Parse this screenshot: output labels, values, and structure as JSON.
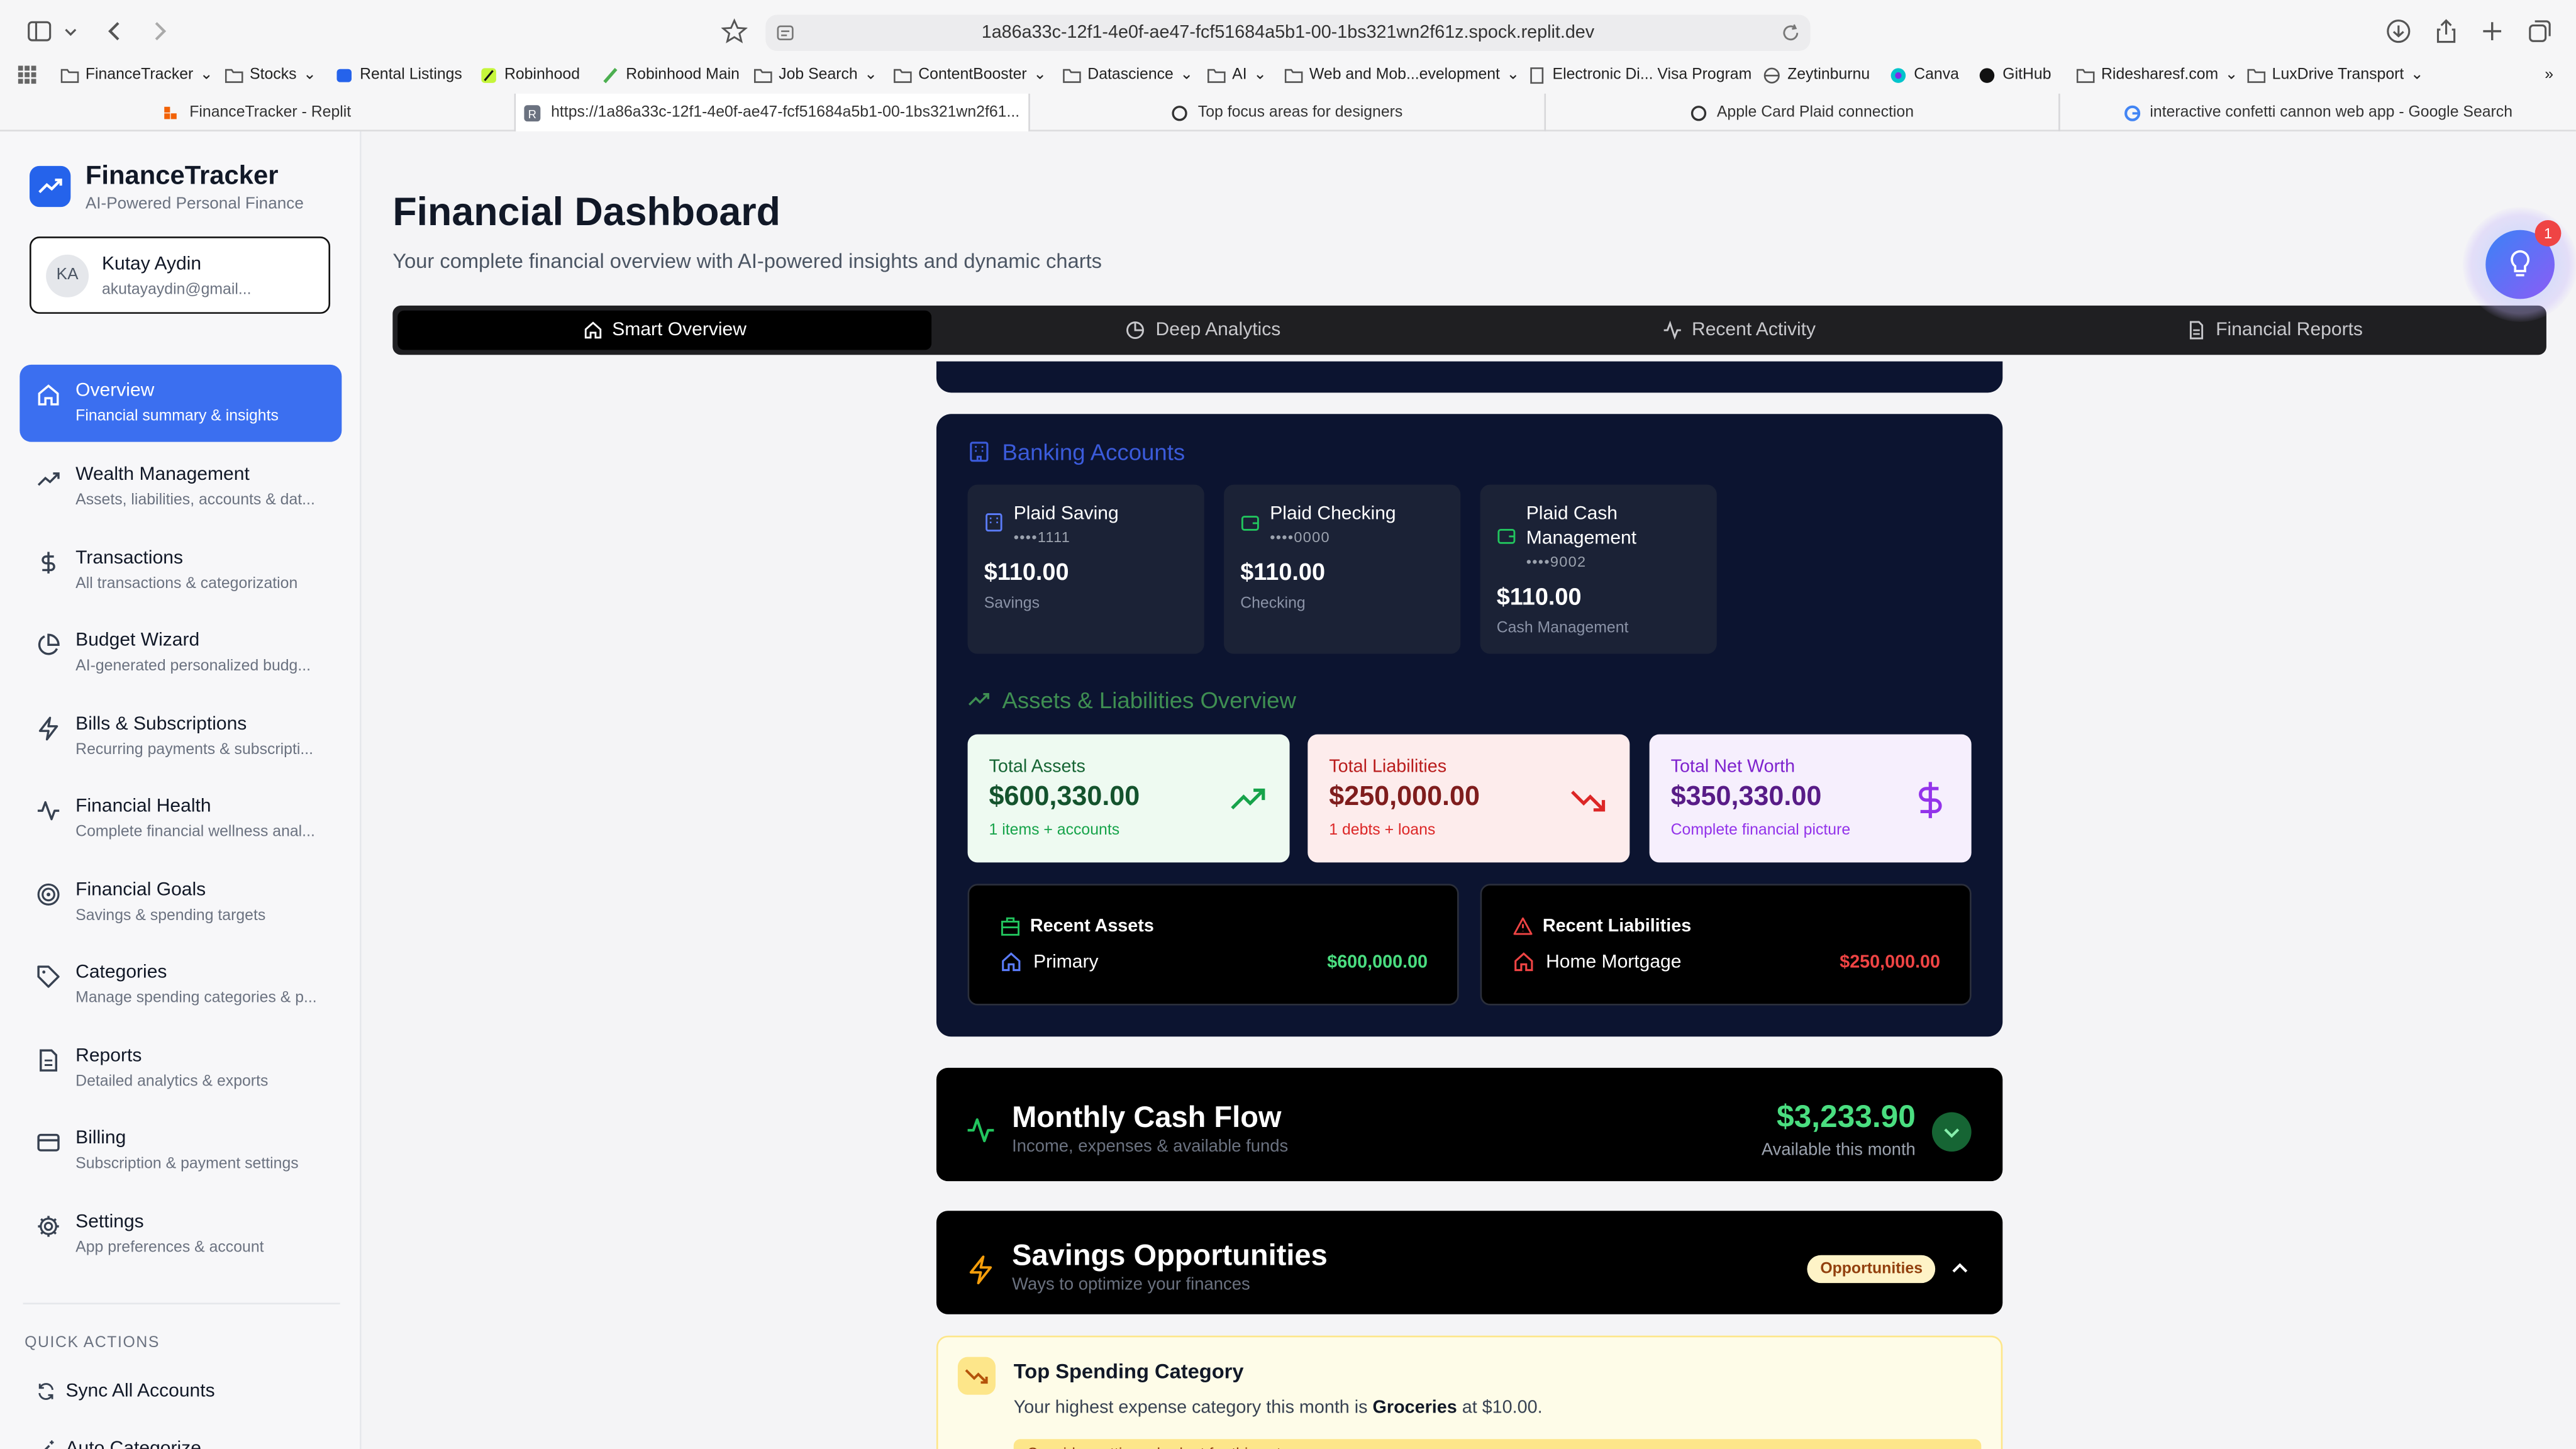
{
  "browser": {
    "url": "1a86a33c-12f1-4e0f-ae47-fcf51684a5b1-00-1bs321wn2f61z.spock.replit.dev",
    "bookmarks": [
      "FinanceTracker",
      "Stocks",
      "Rental Listings",
      "Robinhood",
      "Robinhood Main",
      "Job Search",
      "ContentBooster",
      "Datascience",
      "AI",
      "Web and Mob...evelopment",
      "Electronic Di... Visa Program",
      "Zeytinburnu",
      "Canva",
      "GitHub",
      "Ridesharesf.com",
      "LuxDrive Transport"
    ],
    "tabs": [
      "FinanceTracker - Replit",
      "https://1a86a33c-12f1-4e0f-ae47-fcf51684a5b1-00-1bs321wn2f61...",
      "Top focus areas for designers",
      "Apple Card Plaid connection",
      "interactive confetti cannon web app - Google Search"
    ]
  },
  "sidebar": {
    "app_name": "FinanceTracker",
    "app_tagline": "AI-Powered Personal Finance",
    "user": {
      "initials": "KA",
      "name": "Kutay Aydin",
      "email": "akutayaydin@gmail..."
    },
    "items": [
      {
        "label": "Overview",
        "sub": "Financial summary & insights",
        "icon": "home-icon"
      },
      {
        "label": "Wealth Management",
        "sub": "Assets, liabilities, accounts & dat...",
        "icon": "trending-up-icon"
      },
      {
        "label": "Transactions",
        "sub": "All transactions & categorization",
        "icon": "dollar-icon"
      },
      {
        "label": "Budget Wizard",
        "sub": "AI-generated personalized budg...",
        "icon": "pie-chart-icon"
      },
      {
        "label": "Bills & Subscriptions",
        "sub": "Recurring payments & subscripti...",
        "icon": "zap-icon"
      },
      {
        "label": "Financial Health",
        "sub": "Complete financial wellness anal...",
        "icon": "activity-icon"
      },
      {
        "label": "Financial Goals",
        "sub": "Savings & spending targets",
        "icon": "target-icon"
      },
      {
        "label": "Categories",
        "sub": "Manage spending categories & p...",
        "icon": "tag-icon"
      },
      {
        "label": "Reports",
        "sub": "Detailed analytics & exports",
        "icon": "file-icon"
      },
      {
        "label": "Billing",
        "sub": "Subscription & payment settings",
        "icon": "card-icon"
      },
      {
        "label": "Settings",
        "sub": "App preferences & account",
        "icon": "gear-icon"
      }
    ],
    "quick_actions_title": "QUICK ACTIONS",
    "quick_actions": [
      "Sync All Accounts",
      "Auto Categorize"
    ]
  },
  "header": {
    "title": "Financial Dashboard",
    "subtitle": "Your complete financial overview with AI-powered insights and dynamic charts",
    "tabs": [
      "Smart Overview",
      "Deep Analytics",
      "Recent Activity",
      "Financial Reports"
    ],
    "ai_badge_count": "1"
  },
  "banking": {
    "title": "Banking Accounts",
    "accounts": [
      {
        "name": "Plaid Saving",
        "mask": "••••1111",
        "balance": "$110.00",
        "type": "Savings"
      },
      {
        "name": "Plaid Checking",
        "mask": "••••0000",
        "balance": "$110.00",
        "type": "Checking"
      },
      {
        "name": "Plaid Cash Management",
        "mask": "••••9002",
        "balance": "$110.00",
        "type": "Cash Management"
      }
    ]
  },
  "overview": {
    "title": "Assets & Liabilities Overview",
    "assets": {
      "label": "Total Assets",
      "value": "$600,330.00",
      "sub": "1 items + accounts"
    },
    "liabilities": {
      "label": "Total Liabilities",
      "value": "$250,000.00",
      "sub": "1 debts + loans"
    },
    "net_worth": {
      "label": "Total Net Worth",
      "value": "$350,330.00",
      "sub": "Complete financial picture"
    },
    "recent_assets": {
      "title": "Recent Assets",
      "name": "Primary",
      "value": "$600,000.00"
    },
    "recent_liabilities": {
      "title": "Recent Liabilities",
      "name": "Home Mortgage",
      "value": "$250,000.00"
    }
  },
  "cash_flow": {
    "title": "Monthly Cash Flow",
    "subtitle": "Income, expenses & available funds",
    "amount": "$3,233.90",
    "amount_label": "Available this month"
  },
  "savings": {
    "title": "Savings Opportunities",
    "subtitle": "Ways to optimize your finances",
    "pill": "Opportunities"
  },
  "tip": {
    "title": "Top Spending Category",
    "body_prefix": "Your highest expense category this month is ",
    "category": "Groceries",
    "body_mid": " at ",
    "amount": "$10.00",
    "body_suffix": ".",
    "note": "Consider setting a budget for this category"
  },
  "colors": {
    "accent": "#3b6ff0",
    "panel": "#0c1430",
    "green": "#4ade80",
    "red": "#dc2626",
    "purple": "#7e22ce"
  }
}
